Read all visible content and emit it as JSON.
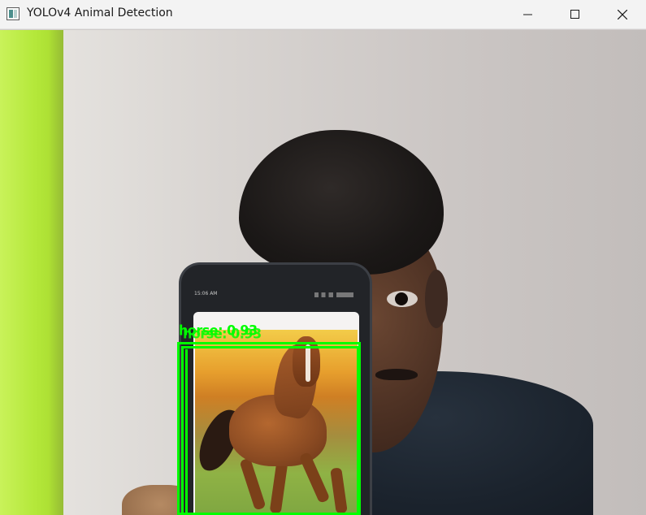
{
  "window": {
    "title": "YOLOv4 Animal Detection",
    "app_icon": "opencv-window-icon",
    "controls": {
      "minimize_icon": "minimize-icon",
      "maximize_icon": "maximize-icon",
      "close_icon": "close-icon"
    }
  },
  "video": {
    "detection": {
      "label": "horse: 0.93",
      "color": "#00ff00"
    },
    "phone_status_time": "15:06 AM"
  },
  "colors": {
    "titlebar_bg": "#f3f3f3",
    "box_color": "#00ff00"
  }
}
